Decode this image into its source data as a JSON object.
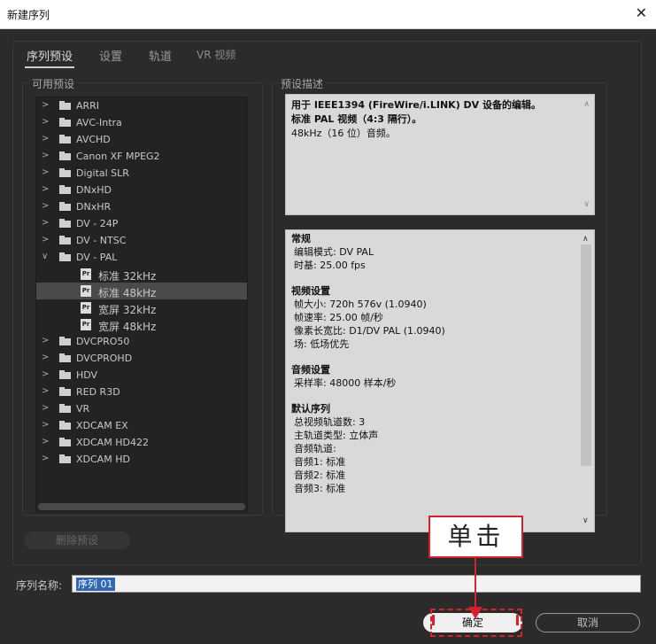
{
  "window": {
    "title": "新建序列",
    "close_glyph": "✕"
  },
  "tabs": [
    {
      "label": "序列预设",
      "active": true
    },
    {
      "label": "设置",
      "active": false
    },
    {
      "label": "轨道",
      "active": false
    },
    {
      "label": "VR 视频",
      "active": false
    }
  ],
  "presets": {
    "group_label": "可用预设",
    "items": [
      {
        "label": "ARRI",
        "expanded": false
      },
      {
        "label": "AVC-Intra",
        "expanded": false
      },
      {
        "label": "AVCHD",
        "expanded": false
      },
      {
        "label": "Canon XF MPEG2",
        "expanded": false
      },
      {
        "label": "Digital SLR",
        "expanded": false
      },
      {
        "label": "DNxHD",
        "expanded": false
      },
      {
        "label": "DNxHR",
        "expanded": false
      },
      {
        "label": "DV - 24P",
        "expanded": false
      },
      {
        "label": "DV - NTSC",
        "expanded": false
      },
      {
        "label": "DV - PAL",
        "expanded": true
      }
    ],
    "children": [
      {
        "label": "标准 32kHz",
        "selected": false
      },
      {
        "label": "标准 48kHz",
        "selected": true
      },
      {
        "label": "宽屏 32kHz",
        "selected": false
      },
      {
        "label": "宽屏 48kHz",
        "selected": false
      }
    ],
    "items_after": [
      {
        "label": "DVCPRO50"
      },
      {
        "label": "DVCPROHD"
      },
      {
        "label": "HDV"
      },
      {
        "label": "RED R3D"
      },
      {
        "label": "VR"
      },
      {
        "label": "XDCAM EX"
      },
      {
        "label": "XDCAM HD422"
      },
      {
        "label": "XDCAM HD"
      }
    ],
    "delete_label": "删除预设"
  },
  "description": {
    "group_label": "预设描述",
    "line1": "用于 IEEE1394 (FireWire/i.LINK) DV 设备的编辑。",
    "line2": "标准 PAL 视频（4:3 隔行）。",
    "line3": "48kHz（16 位）音频。"
  },
  "info": {
    "general_title": "常规",
    "edit_mode": "编辑模式: DV PAL",
    "timebase": "时基: 25.00 fps",
    "video_title": "视频设置",
    "frame_size": "帧大小: 720h 576v (1.0940)",
    "frame_rate": "帧速率: 25.00 帧/秒",
    "pixel_aspect": "像素长宽比: D1/DV PAL (1.0940)",
    "fields": "场: 低场优先",
    "audio_title": "音频设置",
    "sample_rate": "采样率: 48000 样本/秒",
    "default_title": "默认序列",
    "total_video": "总视频轨道数: 3",
    "master_type": "主轨道类型: 立体声",
    "audio_tracks": "音频轨道:",
    "audio1": "音频1: 标准",
    "audio2": "音频2: 标准",
    "audio3": "音频3: 标准"
  },
  "sequence_name": {
    "label": "序列名称:",
    "value": "序列 01"
  },
  "buttons": {
    "ok": "确定",
    "cancel": "取消"
  },
  "annotation": {
    "callout": "单击",
    "color": "#d4232a"
  },
  "colors": {
    "dialog_bg": "#2b2b2b",
    "field_bg": "#d9d9d9",
    "selection": "#3067b5"
  }
}
